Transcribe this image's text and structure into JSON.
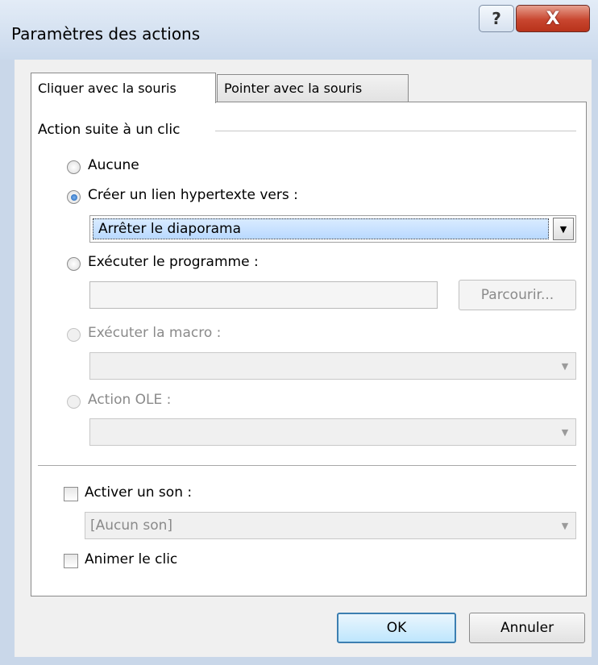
{
  "window": {
    "title": "Paramètres des actions",
    "help_glyph": "?",
    "close_glyph": "X"
  },
  "tabs": [
    {
      "label": "Cliquer avec la souris",
      "active": true
    },
    {
      "label": "Pointer avec la souris",
      "active": false
    }
  ],
  "group": {
    "label": "Action suite à un clic",
    "options": {
      "none": {
        "label": "Aucune",
        "checked": false,
        "enabled": true
      },
      "hyperlink": {
        "label": "Créer un lien hypertexte vers :",
        "checked": true,
        "enabled": true,
        "value": "Arrêter le diaporama"
      },
      "program": {
        "label": "Exécuter le programme :",
        "checked": false,
        "enabled": true,
        "value": "",
        "browse_label": "Parcourir..."
      },
      "macro": {
        "label": "Exécuter la macro :",
        "checked": false,
        "enabled": false,
        "value": ""
      },
      "ole": {
        "label": "Action OLE :",
        "checked": false,
        "enabled": false,
        "value": ""
      }
    }
  },
  "sound": {
    "checkbox_label": "Activer un son :",
    "checked": false,
    "value": "[Aucun son]"
  },
  "animate": {
    "checkbox_label": "Animer le clic",
    "checked": false
  },
  "buttons": {
    "ok": "OK",
    "cancel": "Annuler"
  },
  "colors": {
    "accent": "#3c7fb1",
    "close": "#c8462f"
  }
}
